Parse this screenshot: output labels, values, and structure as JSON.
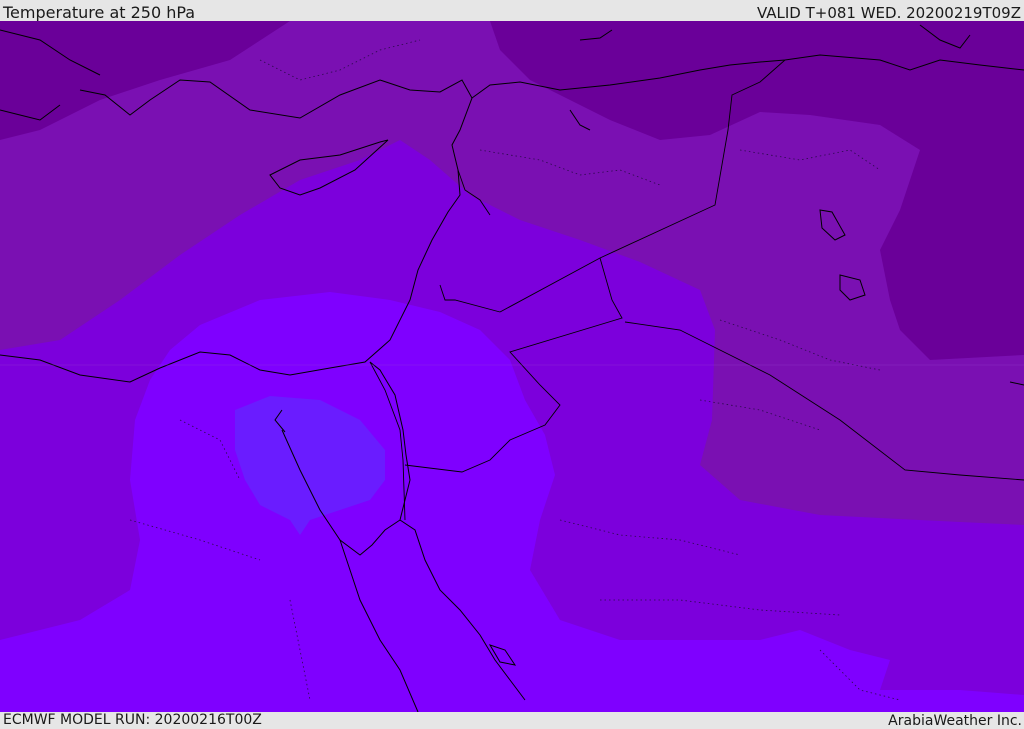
{
  "header": {
    "title": "Temperature at 250 hPa",
    "valid_time": "VALID T+081 WED. 20200219T09Z"
  },
  "footer": {
    "model_run": "ECMWF MODEL RUN: 20200216T00Z",
    "credit": "ArabiaWeather Inc."
  },
  "colors": {
    "darkest": "#6a0099",
    "dark": "#7a10b2",
    "mid": "#7c00dc",
    "light": "#7f00ff",
    "lightest": "#6a1cff",
    "border": "#000000",
    "chrome": "#e6e6e6"
  }
}
